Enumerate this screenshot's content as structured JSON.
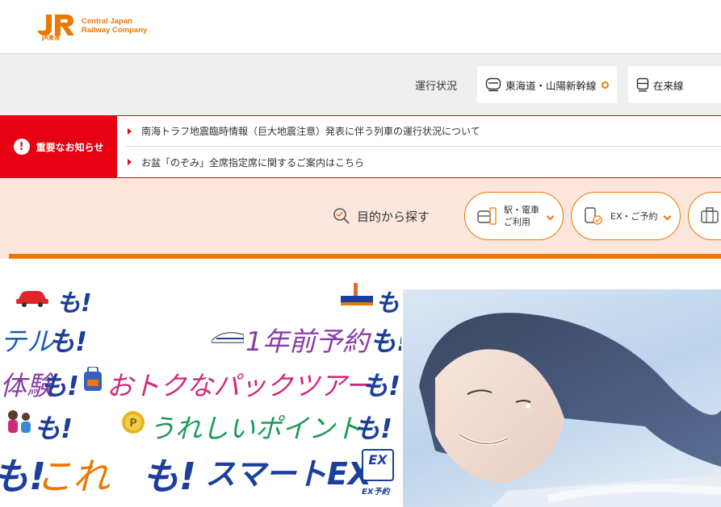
{
  "header": {
    "logo_text_line1": "Central Japan",
    "logo_text_line2": "Railway Company",
    "logo_sub": "JR東海"
  },
  "operation": {
    "label": "運行状況",
    "shinkansen": "東海道・山陽新幹線",
    "conventional": "在来線"
  },
  "notice": {
    "tag": "重要なお知らせ",
    "items": [
      "南海トラフ地震臨時情報（巨大地震注意）発表に伴う列車の運行状況について",
      "お盆「のぞみ」全席指定席に関するご案内はこちら"
    ]
  },
  "purpose": {
    "label": "目的から探す",
    "buttons": [
      {
        "line1": "駅・電車",
        "line2": "ご利用"
      },
      {
        "line1": "EX・ご予約",
        "line2": ""
      }
    ]
  },
  "banner": {
    "line1_mo": "も!",
    "line1b_mo": "も",
    "hotel": "テル",
    "advance": "1年前予約",
    "experience": "体験",
    "package": "おトクなパックツアー",
    "point": "うれしいポイント",
    "this": "これ",
    "smartex": "スマートEX",
    "mo": "も!",
    "ex_badge": "EX",
    "ex_yoyaku": "EX予約"
  },
  "colors": {
    "brand_orange": "#ee7700",
    "alert_red": "#e60012",
    "purpose_bg": "#fde7dc"
  }
}
